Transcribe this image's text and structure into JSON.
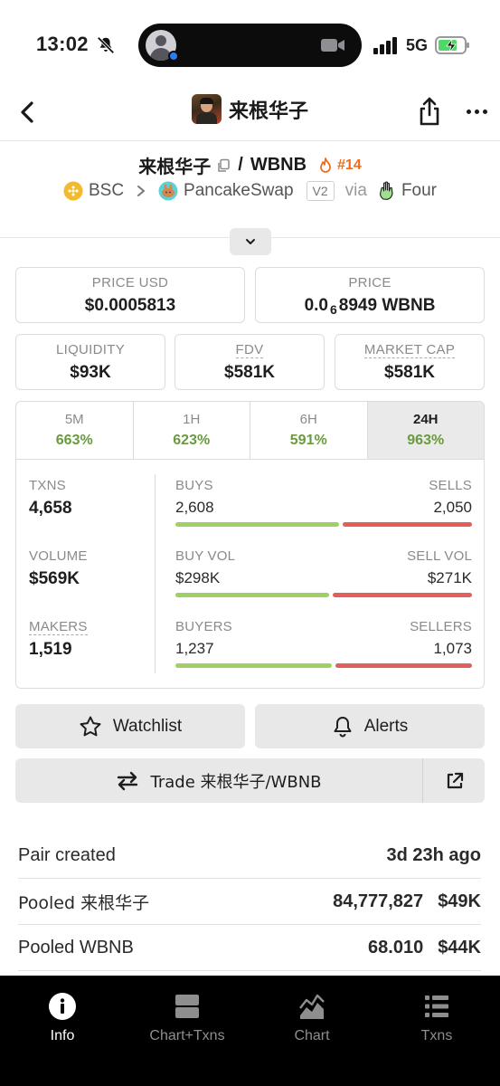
{
  "status_bar": {
    "time": "13:02",
    "network": "5G"
  },
  "header": {
    "title": "来根华子"
  },
  "pair": {
    "base": "来根华子",
    "separator": "/",
    "quote": "WBNB",
    "rank": "#14",
    "chain": "BSC",
    "dex": "PancakeSwap",
    "version": "V2",
    "via_label": "via",
    "launchpad": "Four"
  },
  "price_cards": {
    "price_usd": {
      "label": "PRICE USD",
      "value": "$0.0005813"
    },
    "price": {
      "label": "PRICE",
      "value_prefix": "0.0",
      "value_sub": "6",
      "value_suffix": "8949 WBNB"
    }
  },
  "metric_cards": [
    {
      "label": "LIQUIDITY",
      "value": "$93K"
    },
    {
      "label": "FDV",
      "value": "$581K"
    },
    {
      "label": "MARKET CAP",
      "value": "$581K"
    }
  ],
  "timeframes": [
    {
      "label": "5M",
      "change": "663%"
    },
    {
      "label": "1H",
      "change": "623%"
    },
    {
      "label": "6H",
      "change": "591%"
    },
    {
      "label": "24H",
      "change": "963%"
    }
  ],
  "active_timeframe": "24H",
  "stats": {
    "txns": {
      "label": "TXNS",
      "value": "4,658"
    },
    "volume": {
      "label": "VOLUME",
      "value": "$569K"
    },
    "makers": {
      "label": "MAKERS",
      "value": "1,519"
    },
    "buys": {
      "label": "BUYS",
      "value": "2,608"
    },
    "sells": {
      "label": "SELLS",
      "value": "2,050"
    },
    "buy_vol": {
      "label": "BUY VOL",
      "value": "$298K"
    },
    "sell_vol": {
      "label": "SELL VOL",
      "value": "$271K"
    },
    "buyers": {
      "label": "BUYERS",
      "value": "1,237"
    },
    "sellers": {
      "label": "SELLERS",
      "value": "1,073"
    },
    "ratios": {
      "buys": 0.56,
      "buy_vol": 0.524,
      "buyers": 0.535
    }
  },
  "actions": {
    "watchlist": "Watchlist",
    "alerts": "Alerts",
    "trade": "Trade 来根华子/WBNB"
  },
  "info_rows": [
    {
      "label": "Pair created",
      "value": "3d 23h ago",
      "value2": ""
    },
    {
      "label": "Pooled 来根华子",
      "value": "84,777,827",
      "value2": "$49K"
    },
    {
      "label": "Pooled WBNB",
      "value": "68.010",
      "value2": "$44K"
    }
  ],
  "tabbar": [
    {
      "label": "Info",
      "icon": "info-icon",
      "active": true
    },
    {
      "label": "Chart+Txns",
      "icon": "split-view-icon",
      "active": false
    },
    {
      "label": "Chart",
      "icon": "area-chart-icon",
      "active": false
    },
    {
      "label": "Txns",
      "icon": "list-icon",
      "active": false
    }
  ],
  "colors": {
    "positive": "#6a9a3e",
    "buy_bar": "#a0cf64",
    "sell_bar": "#e3605a",
    "rank": "#f06b1a",
    "tabbar_bg": "#000000"
  }
}
